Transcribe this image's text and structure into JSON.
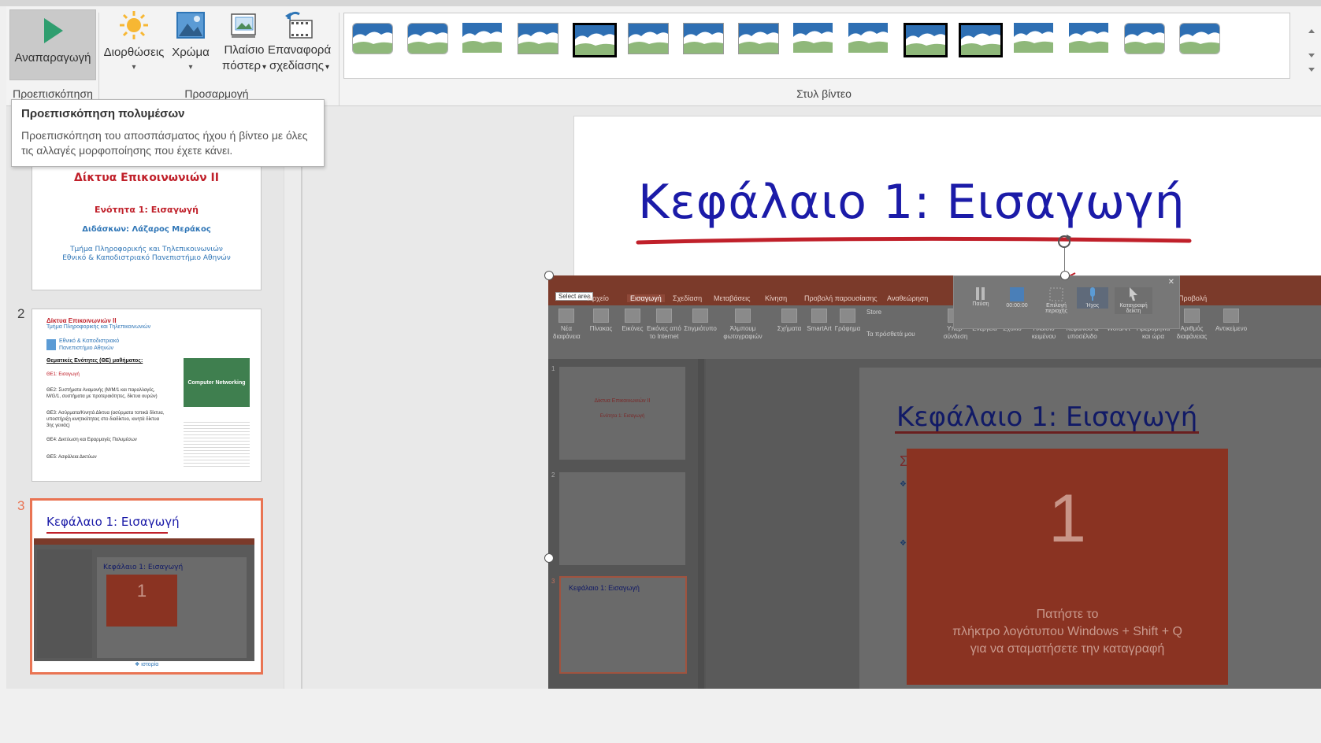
{
  "ribbon": {
    "preview_group": {
      "label": "Προεπισκόπηση",
      "play_label": "Αναπαραγωγή"
    },
    "adjust_group": {
      "label": "Προσαρμογή",
      "corrections_label": "Διορθώσεις",
      "color_label": "Χρώμα",
      "poster_frame_label1": "Πλαίσιο",
      "poster_frame_label2": "πόστερ",
      "reset_design_label1": "Επαναφορά",
      "reset_design_label2": "σχεδίασης",
      "dropdown_arrow": "▾"
    },
    "styles_group": {
      "label": "Στυλ βίντεο"
    }
  },
  "tooltip": {
    "title": "Προεπισκόπηση πολυμέσων",
    "description": "Προεπισκόπηση του αποσπάσματος ήχου ή βίντεο με όλες τις αλλαγές μορφοποίησης που έχετε κάνει."
  },
  "thumbnails": {
    "slide1": {
      "line1": "Δίκτυα Επικοινωνιών ΙΙ",
      "line2": "Ενότητα 1: Εισαγωγή",
      "line3": "Διδάσκων: Λάζαρος Μεράκος",
      "line4": "Τμήμα Πληροφορικής και Τηλεπικοινωνιών",
      "line5": "Εθνικό & Καποδιστριακό Πανεπιστήμιο Αθηνών"
    },
    "slide2": {
      "number": "2",
      "header1": "Δίκτυα Επικοινωνιών ΙΙ",
      "header2": "Τμήμα Πληροφορικής και Τηλεπικοινωνιών",
      "uni": "Εθνικό & Καποδιστριακό Πανεπιστήμιο Αθηνών",
      "section": "Θεματικές Ενότητες (ΘΕ) μαθήματος:",
      "items": [
        "ΘΕ1: Εισαγωγή",
        "ΘΕ2: Συστήματα Αναμονής (M/M/1 και παραλλαγές, M/G/1, συστήματα με προτεραιότητες, δίκτυα ουρών)",
        "ΘΕ3: Ασύρματα/Κινητά Δίκτυα (ασύρματα τοπικά δίκτυα, υποστήριξη κινητικότητας στο διαδίκτυο, κινητά δίκτυα 3ης γενιάς)",
        "ΘΕ4: Δικτύωση και Εφαρμογές Πολυμέσων",
        "ΘΕ5: Ασφάλεια Δικτύων"
      ],
      "book_title": "Computer Networking"
    },
    "slide3": {
      "number": "3",
      "title": "Κεφάλαιο 1: Εισαγωγή",
      "inner_title": "Κεφάλαιο 1: Εισαγωγή",
      "inner_num": "1",
      "footer": "ιστορία"
    }
  },
  "main_slide": {
    "title": "Κεφάλαιο 1: Εισαγωγή"
  },
  "embedded": {
    "select_area": "Select area",
    "tabs": [
      "Αρχείο",
      "Εισαγωγή",
      "Σχεδίαση",
      "Μεταβάσεις",
      "Κίνηση",
      "Προβολή παρουσίασης",
      "Αναθεώρηση",
      "Προβολή"
    ],
    "ribbon_buttons": [
      "Νέα διαφάνεια",
      "Πίνακας",
      "Εικόνες",
      "Εικόνες από το Internet",
      "Στιγμιότυπο",
      "Άλμπουμ φωτογραφιών",
      "Σχήματα",
      "SmartArt",
      "Γράφημα",
      "Store",
      "Τα πρόσθετά μου",
      "Υπερ-σύνδεση",
      "Ενέργεια",
      "Σχόλιο",
      "Πλαίσιο κειμένου",
      "Κεφαλίδα & υποσέλιδο",
      "WordArt",
      "Ημερομηνία και ώρα",
      "Αριθμός διαφάνειας",
      "Αντικείμενο"
    ],
    "recorder": {
      "pause": "Παύση",
      "time": "00:00:00",
      "select": "Επιλογή περιοχής",
      "audio": "Ήχος",
      "pointer": "Καταγραφή δείκτη"
    },
    "slide_title": "Κεφάλαιο 1: Εισαγωγή",
    "countdown_number": "1",
    "countdown_msg1": "Πατήστε το",
    "countdown_msg2": "πλήκτρο λογότυπου Windows + Shift + Q",
    "countdown_msg3": "για να σταματήσετε την καταγραφή",
    "thumb1_line1": "Δίκτυα Επικοινωνιών ΙΙ",
    "thumb1_line2": "Ενότητα 1: Εισαγωγή",
    "thumb3_title": "Κεφάλαιο 1: Εισαγωγή",
    "num1": "1",
    "num2": "2",
    "num3": "3"
  },
  "colors": {
    "accent_selection": "#e97453",
    "title_blue": "#1b1ba8",
    "dark_red": "#8a3322"
  }
}
